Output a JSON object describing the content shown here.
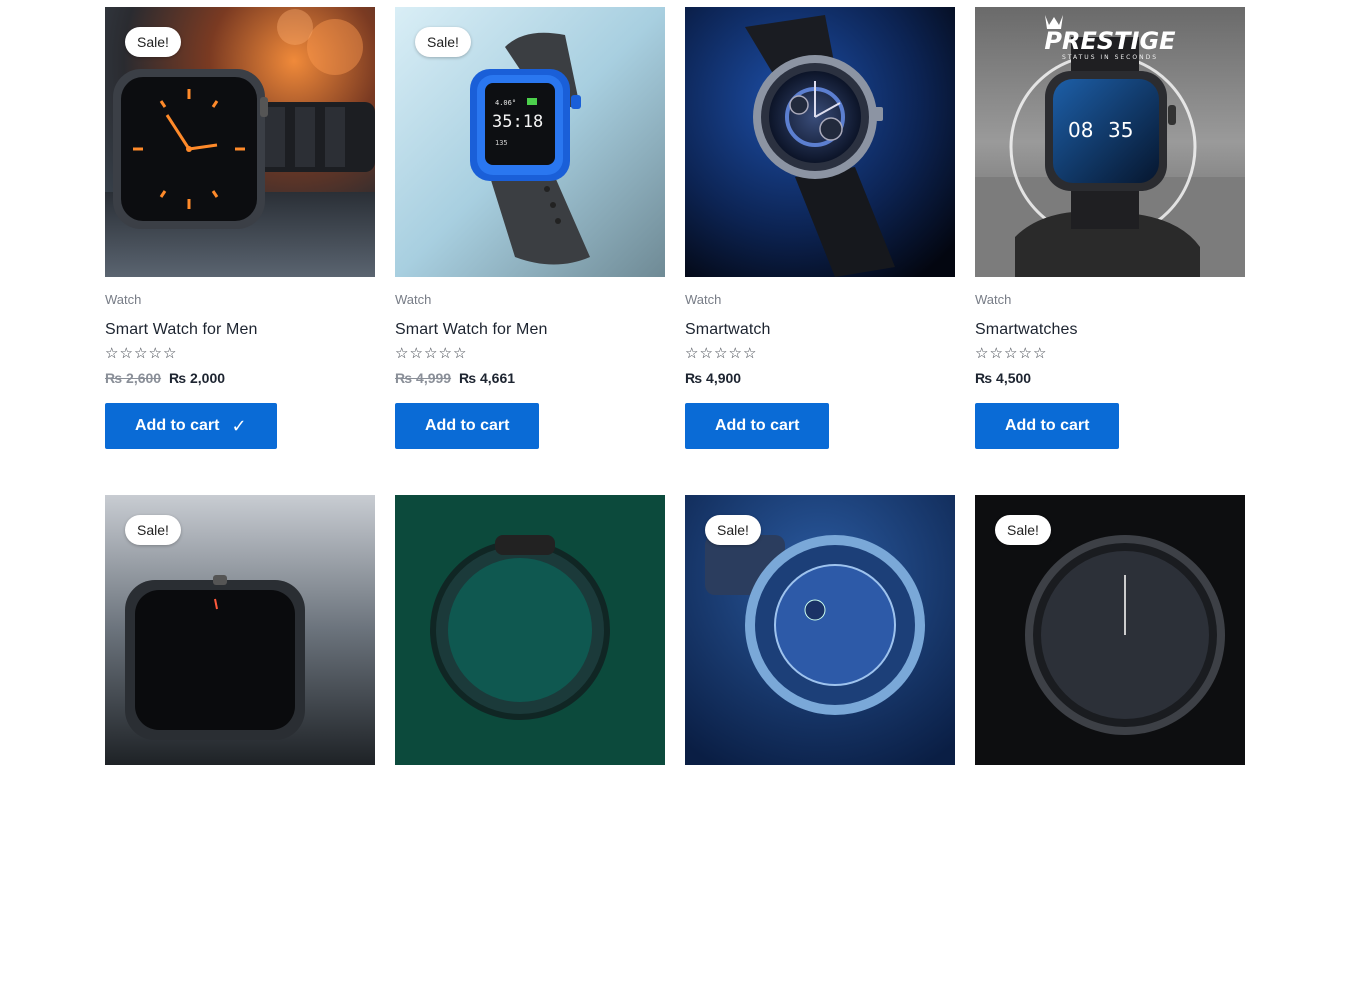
{
  "products": [
    {
      "sale": "Sale!",
      "category": "Watch",
      "title": "Smart Watch for Men",
      "stars": "☆☆☆☆☆",
      "price_old": "₨ 2,600",
      "price": "₨ 2,000",
      "button": "Add to cart",
      "check": "✓"
    },
    {
      "sale": "Sale!",
      "category": "Watch",
      "title": "Smart Watch for Men",
      "stars": "☆☆☆☆☆",
      "price_old": "₨ 4,999",
      "price": "₨ 4,661",
      "button": "Add to cart",
      "screen_text_top": "4.06°",
      "screen_time": "35:18",
      "screen_text_bottom": "135"
    },
    {
      "category": "Watch",
      "title": "Smartwatch",
      "stars": "☆☆☆☆☆",
      "price": "₨ 4,900",
      "button": "Add to cart"
    },
    {
      "category": "Watch",
      "title": "Smartwatches",
      "stars": "☆☆☆☆☆",
      "price": "₨ 4,500",
      "button": "Add to cart",
      "brand": "PRESTIGE",
      "tagline": "STATUS IN SECONDS",
      "screen_time_h": "08",
      "screen_time_m": "35"
    },
    {
      "sale": "Sale!"
    },
    {},
    {
      "sale": "Sale!"
    },
    {
      "sale": "Sale!"
    }
  ],
  "colors": {
    "button": "#0a6bd6",
    "text": "#1d2430",
    "muted": "#777c86"
  }
}
